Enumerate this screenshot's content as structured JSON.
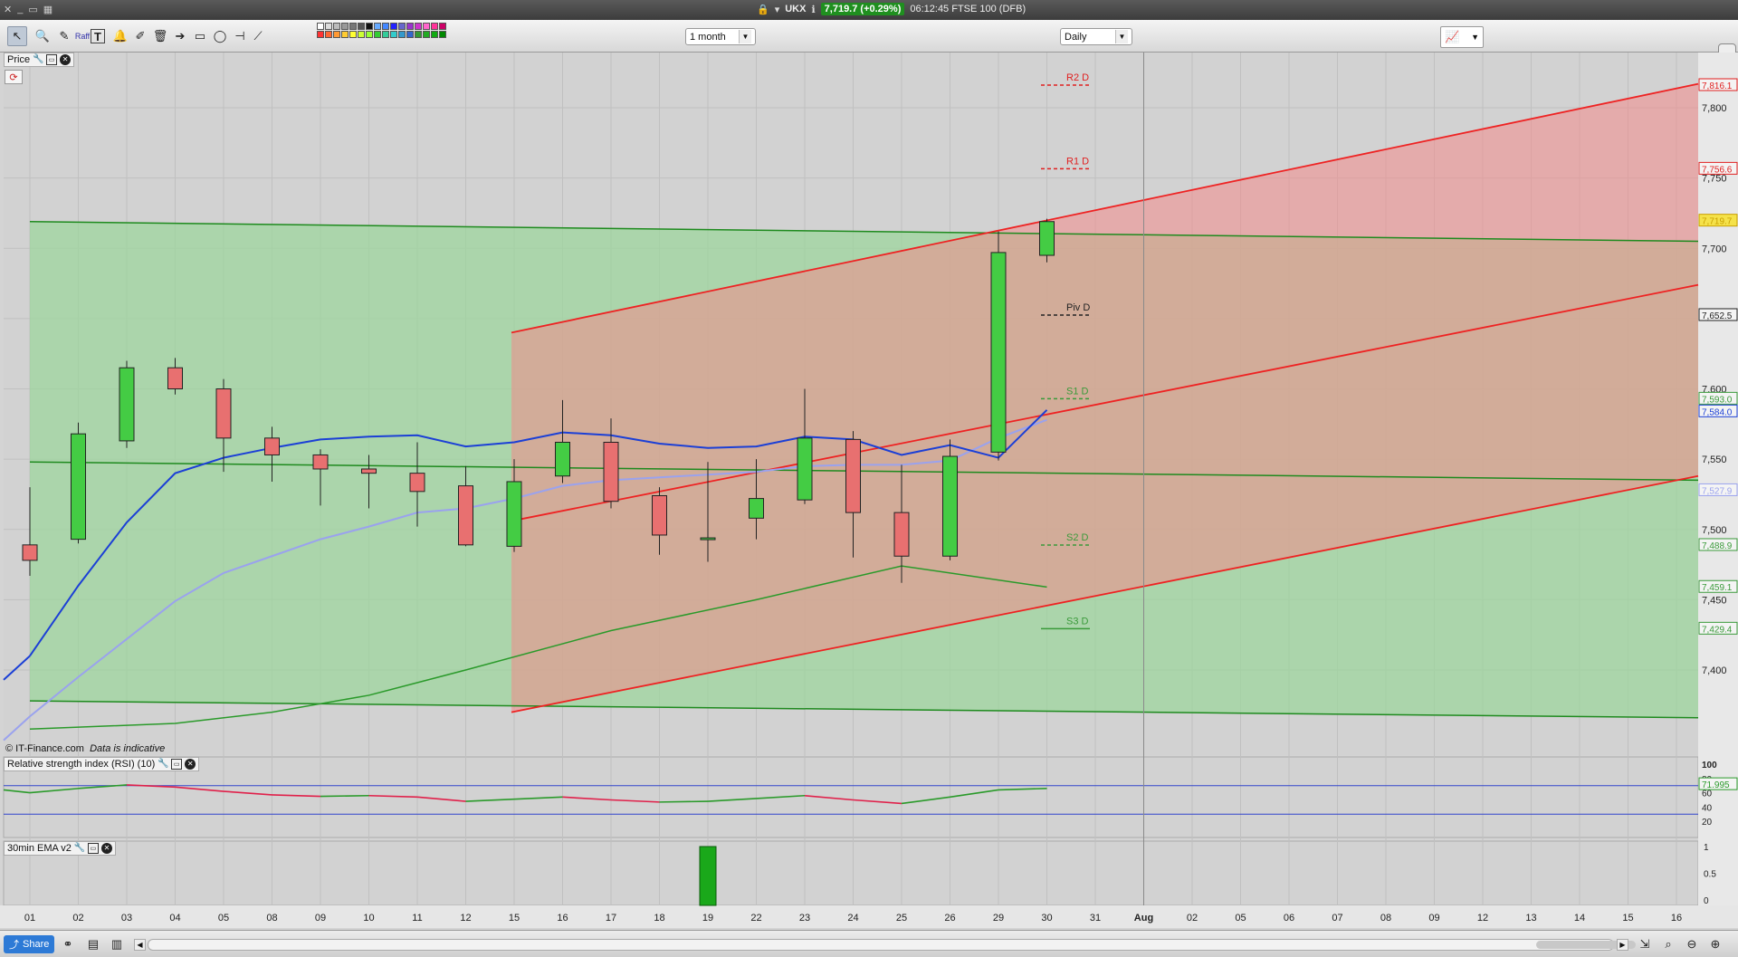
{
  "window": {
    "symbol": "UKX",
    "price_badge": "7,719.7 (+0.29%)",
    "timestamp": "06:12:45 FTSE 100 (DFB)"
  },
  "toolbar": {
    "period": "1 month",
    "interval": "Daily",
    "label_raff": "Raff"
  },
  "panels": {
    "price": "Price",
    "rsi": "Relative strength index (RSI) (10)",
    "ema": "30min EMA v2"
  },
  "credit": {
    "source": "© IT-Finance.com",
    "note": "Data is indicative"
  },
  "bottom": {
    "share": "Share"
  },
  "colors": {
    "bull": "#44cc44",
    "bear": "#e87070",
    "ema_fast": "#1b3fd6",
    "ema_slow": "#9aa2ee",
    "channel_red": "#ee2222",
    "channel_green": "#1e8a1e"
  },
  "chart_data": {
    "type": "candlestick",
    "interval": "Daily",
    "y_axis": {
      "min": 7400,
      "max": 7800,
      "ticks": [
        "7,400",
        "7,450",
        "7,500",
        "7,550",
        "7,600",
        "7,650",
        "7,700",
        "7,750",
        "7,800"
      ]
    },
    "x_labels": [
      "01",
      "02",
      "03",
      "04",
      "05",
      "08",
      "09",
      "10",
      "11",
      "12",
      "15",
      "16",
      "17",
      "18",
      "19",
      "22",
      "23",
      "24",
      "25",
      "26",
      "29",
      "30",
      "31",
      "Aug",
      "02",
      "05",
      "06",
      "07",
      "08",
      "09",
      "12",
      "13",
      "14",
      "15",
      "16"
    ],
    "candles": [
      {
        "x": "01",
        "o": 7489,
        "h": 7530,
        "l": 7467,
        "c": 7478
      },
      {
        "x": "02",
        "o": 7493,
        "h": 7576,
        "l": 7490,
        "c": 7568
      },
      {
        "x": "03",
        "o": 7563,
        "h": 7620,
        "l": 7558,
        "c": 7615
      },
      {
        "x": "04",
        "o": 7615,
        "h": 7622,
        "l": 7596,
        "c": 7600
      },
      {
        "x": "05",
        "o": 7600,
        "h": 7607,
        "l": 7541,
        "c": 7565
      },
      {
        "x": "08",
        "o": 7565,
        "h": 7573,
        "l": 7534,
        "c": 7553
      },
      {
        "x": "09",
        "o": 7553,
        "h": 7557,
        "l": 7517,
        "c": 7543
      },
      {
        "x": "10",
        "o": 7543,
        "h": 7553,
        "l": 7515,
        "c": 7540
      },
      {
        "x": "11",
        "o": 7540,
        "h": 7562,
        "l": 7502,
        "c": 7527
      },
      {
        "x": "12",
        "o": 7531,
        "h": 7545,
        "l": 7488,
        "c": 7489
      },
      {
        "x": "15",
        "o": 7488,
        "h": 7550,
        "l": 7484,
        "c": 7534
      },
      {
        "x": "16",
        "o": 7538,
        "h": 7592,
        "l": 7533,
        "c": 7562
      },
      {
        "x": "17",
        "o": 7562,
        "h": 7579,
        "l": 7515,
        "c": 7520
      },
      {
        "x": "18",
        "o": 7524,
        "h": 7530,
        "l": 7482,
        "c": 7496
      },
      {
        "x": "19",
        "o": 7493,
        "h": 7548,
        "l": 7477,
        "c": 7494
      },
      {
        "x": "22",
        "o": 7508,
        "h": 7550,
        "l": 7493,
        "c": 7522
      },
      {
        "x": "23",
        "o": 7521,
        "h": 7600,
        "l": 7518,
        "c": 7565
      },
      {
        "x": "24",
        "o": 7564,
        "h": 7570,
        "l": 7480,
        "c": 7512
      },
      {
        "x": "25",
        "o": 7512,
        "h": 7546,
        "l": 7462,
        "c": 7481
      },
      {
        "x": "26",
        "o": 7481,
        "h": 7564,
        "l": 7478,
        "c": 7552
      },
      {
        "x": "29",
        "o": 7555,
        "h": 7712,
        "l": 7549,
        "c": 7697
      },
      {
        "x": "30",
        "o": 7695,
        "h": 7721,
        "l": 7690,
        "c": 7719
      }
    ],
    "ema_fast": [
      [
        0,
        7410
      ],
      [
        1,
        7460
      ],
      [
        2,
        7505
      ],
      [
        3,
        7540
      ],
      [
        4,
        7551
      ],
      [
        5,
        7558
      ],
      [
        6,
        7564
      ],
      [
        7,
        7566
      ],
      [
        8,
        7567
      ],
      [
        9,
        7559
      ],
      [
        10,
        7562
      ],
      [
        11,
        7569
      ],
      [
        12,
        7567
      ],
      [
        13,
        7561
      ],
      [
        14,
        7558
      ],
      [
        15,
        7559
      ],
      [
        16,
        7566
      ],
      [
        17,
        7564
      ],
      [
        18,
        7553
      ],
      [
        19,
        7560
      ],
      [
        20,
        7551
      ],
      [
        21,
        7585
      ]
    ],
    "ema_slow": [
      [
        0,
        7367
      ],
      [
        1,
        7395
      ],
      [
        2,
        7422
      ],
      [
        3,
        7449
      ],
      [
        4,
        7469
      ],
      [
        5,
        7481
      ],
      [
        6,
        7493
      ],
      [
        7,
        7502
      ],
      [
        8,
        7512
      ],
      [
        9,
        7515
      ],
      [
        10,
        7522
      ],
      [
        11,
        7531
      ],
      [
        12,
        7535
      ],
      [
        13,
        7537
      ],
      [
        14,
        7539
      ],
      [
        15,
        7541
      ],
      [
        16,
        7545
      ],
      [
        17,
        7546
      ],
      [
        18,
        7546
      ],
      [
        19,
        7549
      ],
      [
        20,
        7565
      ],
      [
        21,
        7578
      ]
    ],
    "pivots": [
      {
        "label": "R2 D",
        "value": 7816.1,
        "color": "#e02020"
      },
      {
        "label": "R1 D",
        "value": 7756.6,
        "color": "#e02020"
      },
      {
        "label": "Piv D",
        "value": 7652.5,
        "color": "#222222"
      },
      {
        "label": "S1 D",
        "value": 7593.0,
        "color": "#3a9a3a"
      },
      {
        "label": "S2 D",
        "value": 7488.9,
        "color": "#3a9a3a"
      },
      {
        "label": "S3 D",
        "value": 7429.4,
        "color": "#3a9a3a"
      }
    ],
    "price_labels": [
      {
        "text": "7,816.1",
        "color": "#e02020"
      },
      {
        "text": "7,756.6",
        "color": "#e02020"
      },
      {
        "text": "7,719.7",
        "color": "#c8a000"
      },
      {
        "text": "7,652.5",
        "color": "#222222"
      },
      {
        "text": "7,593.0",
        "color": "#3a9a3a"
      },
      {
        "text": "7,584.0",
        "color": "#1b3fd6"
      },
      {
        "text": "7,527.9",
        "color": "#9aa2ee"
      },
      {
        "text": "7,488.9",
        "color": "#3a9a3a"
      },
      {
        "text": "7,459.1",
        "color": "#3a9a3a"
      },
      {
        "text": "7,429.4",
        "color": "#3a9a3a"
      }
    ],
    "rsi": {
      "y_ticks": [
        "100",
        "80",
        "60",
        "40",
        "20"
      ],
      "current": "71.995",
      "values": [
        60,
        66,
        71,
        68,
        62,
        57,
        55,
        56,
        54,
        48,
        51,
        54,
        50,
        47,
        48,
        52,
        56,
        50,
        45,
        54,
        64,
        66
      ]
    },
    "ema_panel": {
      "y_ticks": [
        "1",
        "0.5",
        "0"
      ],
      "bar_at": "19",
      "bar_value": 1
    }
  }
}
